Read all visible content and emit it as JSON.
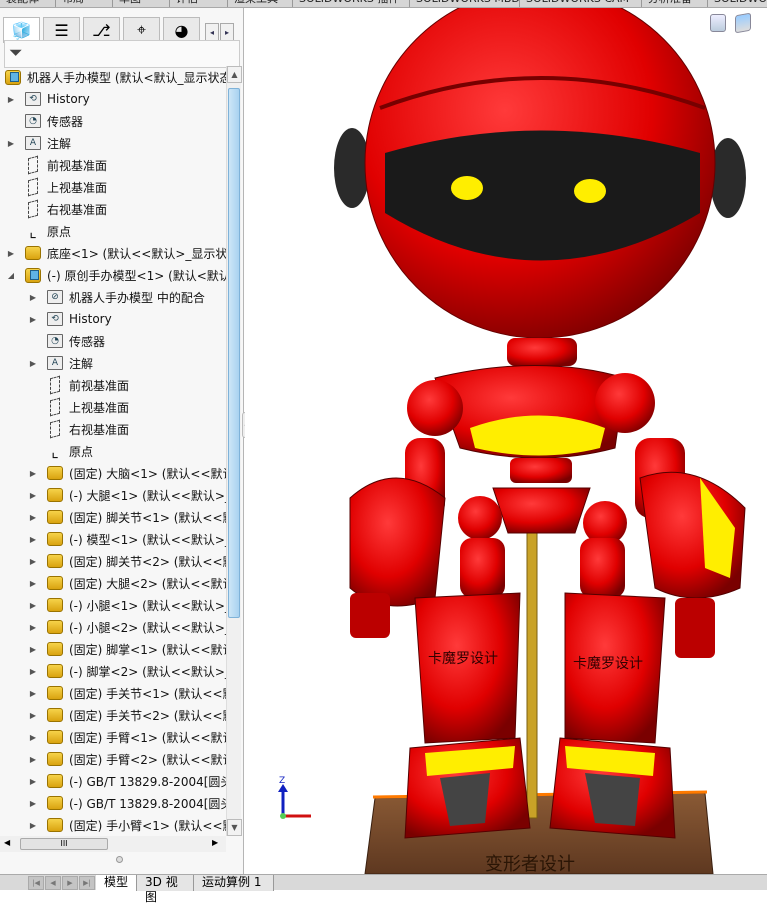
{
  "ribbon_tabs": [
    "装配体",
    "布局",
    "草图",
    "评估",
    "渲染工具",
    "SOLIDWORKS 插件",
    "SOLIDWORKS MBD",
    "SOLIDWORKS CAM",
    "分析准备",
    "SOLIDWORKS"
  ],
  "panel": {
    "tabs": [
      {
        "icon": "feature-manager-icon"
      },
      {
        "icon": "property-manager-icon"
      },
      {
        "icon": "configuration-manager-icon"
      },
      {
        "icon": "dimxpert-icon"
      },
      {
        "icon": "display-manager-icon"
      }
    ],
    "filter_icon": "funnel-icon",
    "tree": [
      {
        "level": 0,
        "icon": "assembly",
        "arrow": "",
        "label": "机器人手办模型  (默认<默认_显示状态"
      },
      {
        "level": 1,
        "icon": "history",
        "arrow": "right",
        "label": "History"
      },
      {
        "level": 1,
        "icon": "sensor",
        "arrow": "",
        "label": "传感器"
      },
      {
        "level": 1,
        "icon": "annotation",
        "arrow": "right",
        "label": "注解"
      },
      {
        "level": 1,
        "icon": "plane",
        "arrow": "",
        "label": "前视基准面"
      },
      {
        "level": 1,
        "icon": "plane",
        "arrow": "",
        "label": "上视基准面"
      },
      {
        "level": 1,
        "icon": "plane",
        "arrow": "",
        "label": "右视基准面"
      },
      {
        "level": 1,
        "icon": "origin",
        "arrow": "",
        "label": "原点"
      },
      {
        "level": 1,
        "icon": "part",
        "arrow": "right",
        "label": "底座<1> (默认<<默认>_显示状"
      },
      {
        "level": 1,
        "icon": "assembly",
        "arrow": "down",
        "label": "(-) 原创手办模型<1> (默认<默认"
      },
      {
        "level": 2,
        "icon": "mates",
        "arrow": "right",
        "label": "机器人手办模型 中的配合"
      },
      {
        "level": 2,
        "icon": "history",
        "arrow": "right",
        "label": "History"
      },
      {
        "level": 2,
        "icon": "sensor",
        "arrow": "",
        "label": "传感器"
      },
      {
        "level": 2,
        "icon": "annotation",
        "arrow": "right",
        "label": "注解"
      },
      {
        "level": 2,
        "icon": "plane",
        "arrow": "",
        "label": "前视基准面"
      },
      {
        "level": 2,
        "icon": "plane",
        "arrow": "",
        "label": "上视基准面"
      },
      {
        "level": 2,
        "icon": "plane",
        "arrow": "",
        "label": "右视基准面"
      },
      {
        "level": 2,
        "icon": "origin",
        "arrow": "",
        "label": "原点"
      },
      {
        "level": 2,
        "icon": "part",
        "arrow": "right",
        "label": "(固定) 大脑<1> (默认<<默认"
      },
      {
        "level": 2,
        "icon": "part",
        "arrow": "right",
        "label": "(-) 大腿<1> (默认<<默认>_"
      },
      {
        "level": 2,
        "icon": "part",
        "arrow": "right",
        "label": "(固定) 脚关节<1> (默认<<默"
      },
      {
        "level": 2,
        "icon": "part",
        "arrow": "right",
        "label": "(-) 模型<1> (默认<<默认>_"
      },
      {
        "level": 2,
        "icon": "part",
        "arrow": "right",
        "label": "(固定) 脚关节<2> (默认<<默"
      },
      {
        "level": 2,
        "icon": "part",
        "arrow": "right",
        "label": "(固定) 大腿<2> (默认<<默认"
      },
      {
        "level": 2,
        "icon": "part",
        "arrow": "right",
        "label": "(-) 小腿<1> (默认<<默认>_"
      },
      {
        "level": 2,
        "icon": "part",
        "arrow": "right",
        "label": "(-) 小腿<2> (默认<<默认>_"
      },
      {
        "level": 2,
        "icon": "part",
        "arrow": "right",
        "label": "(固定) 脚掌<1> (默认<<默认"
      },
      {
        "level": 2,
        "icon": "part",
        "arrow": "right",
        "label": "(-) 脚掌<2> (默认<<默认>_"
      },
      {
        "level": 2,
        "icon": "part",
        "arrow": "right",
        "label": "(固定) 手关节<1> (默认<<默"
      },
      {
        "level": 2,
        "icon": "part",
        "arrow": "right",
        "label": "(固定) 手关节<2> (默认<<默"
      },
      {
        "level": 2,
        "icon": "part",
        "arrow": "right",
        "label": "(固定) 手臂<1> (默认<<默认"
      },
      {
        "level": 2,
        "icon": "part",
        "arrow": "right",
        "label": "(固定) 手臂<2> (默认<<默认"
      },
      {
        "level": 2,
        "icon": "part",
        "arrow": "right",
        "label": "(-) GB/T 13829.8-2004[圆头"
      },
      {
        "level": 2,
        "icon": "part",
        "arrow": "right",
        "label": "(-) GB/T 13829.8-2004[圆头"
      },
      {
        "level": 2,
        "icon": "part",
        "arrow": "right",
        "label": "(固定) 手小臂<1> (默认<<默"
      }
    ]
  },
  "bottom_tabs": [
    {
      "label": "模型",
      "active": true
    },
    {
      "label": "3D 视图",
      "active": false
    },
    {
      "label": "运动算例 1",
      "active": false
    }
  ],
  "viewport": {
    "triad_label": "Z",
    "base_text": "变形者设计",
    "leg_text": "卡魔罗设计",
    "colors": {
      "body": "#e00000",
      "accent": "#ffee00",
      "visor": "#1a1a1a",
      "base": "#7a4a2a",
      "pole": "#c9a227"
    }
  }
}
